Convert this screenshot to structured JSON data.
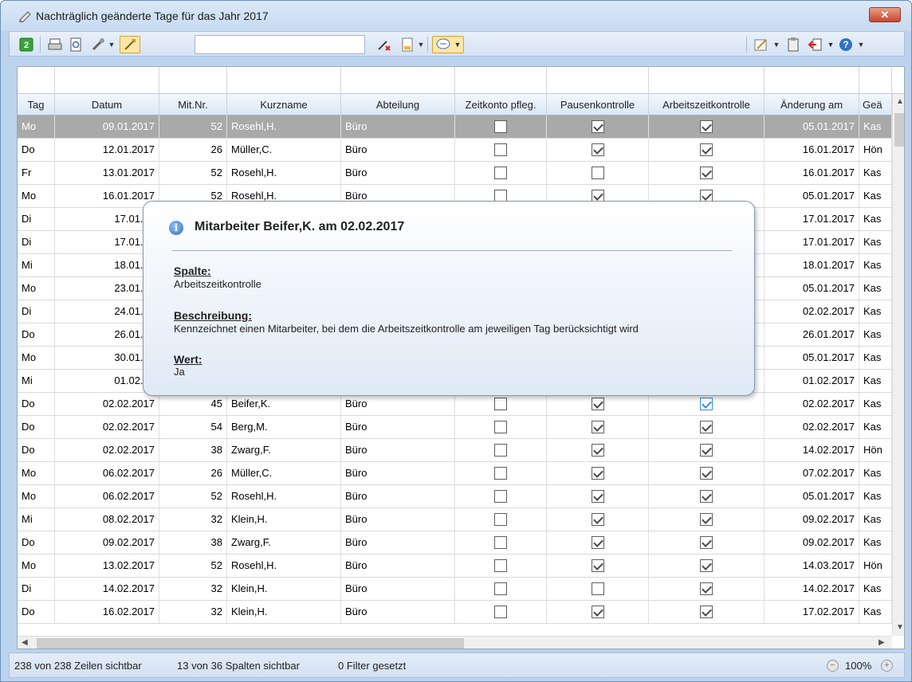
{
  "window": {
    "title": "Nachträglich geänderte Tage für das Jahr 2017",
    "close_label": "✕"
  },
  "toolbar": {
    "search_value": ""
  },
  "columns": [
    "Tag",
    "Datum",
    "Mit.Nr.",
    "Kurzname",
    "Abteilung",
    "Zeitkonto pfleg.",
    "Pausenkontrolle",
    "Arbeitszeitkontrolle",
    "Änderung am",
    "Geä"
  ],
  "rows": [
    {
      "tag": "Mo",
      "datum": "09.01.2017",
      "nr": "52",
      "kurz": "Rosehl,H.",
      "abt": "Büro",
      "zk": false,
      "pk": true,
      "ak": true,
      "aend": "05.01.2017",
      "gea": "Kas",
      "selected": true
    },
    {
      "tag": "Do",
      "datum": "12.01.2017",
      "nr": "26",
      "kurz": "Müller,C.",
      "abt": "Büro",
      "zk": false,
      "pk": true,
      "ak": true,
      "aend": "16.01.2017",
      "gea": "Hön"
    },
    {
      "tag": "Fr",
      "datum": "13.01.2017",
      "nr": "52",
      "kurz": "Rosehl,H.",
      "abt": "Büro",
      "zk": false,
      "pk": false,
      "ak": true,
      "aend": "16.01.2017",
      "gea": "Kas"
    },
    {
      "tag": "Mo",
      "datum": "16.01.2017",
      "nr": "52",
      "kurz": "Rosehl,H.",
      "abt": "Büro",
      "zk": false,
      "pk": true,
      "ak": true,
      "aend": "05.01.2017",
      "gea": "Kas"
    },
    {
      "tag": "Di",
      "datum": "17.01.20",
      "nr": "",
      "kurz": "",
      "abt": "",
      "zk": null,
      "pk": null,
      "ak": null,
      "aend": "17.01.2017",
      "gea": "Kas"
    },
    {
      "tag": "Di",
      "datum": "17.01.20",
      "nr": "",
      "kurz": "",
      "abt": "",
      "zk": null,
      "pk": null,
      "ak": null,
      "aend": "17.01.2017",
      "gea": "Kas"
    },
    {
      "tag": "Mi",
      "datum": "18.01.20",
      "nr": "",
      "kurz": "",
      "abt": "",
      "zk": null,
      "pk": null,
      "ak": null,
      "aend": "18.01.2017",
      "gea": "Kas"
    },
    {
      "tag": "Mo",
      "datum": "23.01.20",
      "nr": "",
      "kurz": "",
      "abt": "",
      "zk": null,
      "pk": null,
      "ak": null,
      "aend": "05.01.2017",
      "gea": "Kas"
    },
    {
      "tag": "Di",
      "datum": "24.01.20",
      "nr": "",
      "kurz": "",
      "abt": "",
      "zk": null,
      "pk": null,
      "ak": null,
      "aend": "02.02.2017",
      "gea": "Kas"
    },
    {
      "tag": "Do",
      "datum": "26.01.20",
      "nr": "",
      "kurz": "",
      "abt": "",
      "zk": null,
      "pk": null,
      "ak": null,
      "aend": "26.01.2017",
      "gea": "Kas"
    },
    {
      "tag": "Mo",
      "datum": "30.01.20",
      "nr": "",
      "kurz": "",
      "abt": "",
      "zk": null,
      "pk": null,
      "ak": null,
      "aend": "05.01.2017",
      "gea": "Kas"
    },
    {
      "tag": "Mi",
      "datum": "01.02.20",
      "nr": "",
      "kurz": "",
      "abt": "",
      "zk": null,
      "pk": null,
      "ak": null,
      "aend": "01.02.2017",
      "gea": "Kas"
    },
    {
      "tag": "Do",
      "datum": "02.02.2017",
      "nr": "45",
      "kurz": "Beifer,K.",
      "abt": "Büro",
      "zk": false,
      "pk": true,
      "ak": true,
      "aend": "02.02.2017",
      "gea": "Kas",
      "blue": true
    },
    {
      "tag": "Do",
      "datum": "02.02.2017",
      "nr": "54",
      "kurz": "Berg,M.",
      "abt": "Büro",
      "zk": false,
      "pk": true,
      "ak": true,
      "aend": "02.02.2017",
      "gea": "Kas"
    },
    {
      "tag": "Do",
      "datum": "02.02.2017",
      "nr": "38",
      "kurz": "Zwarg,F.",
      "abt": "Büro",
      "zk": false,
      "pk": true,
      "ak": true,
      "aend": "14.02.2017",
      "gea": "Hön"
    },
    {
      "tag": "Mo",
      "datum": "06.02.2017",
      "nr": "26",
      "kurz": "Müller,C.",
      "abt": "Büro",
      "zk": false,
      "pk": true,
      "ak": true,
      "aend": "07.02.2017",
      "gea": "Kas"
    },
    {
      "tag": "Mo",
      "datum": "06.02.2017",
      "nr": "52",
      "kurz": "Rosehl,H.",
      "abt": "Büro",
      "zk": false,
      "pk": true,
      "ak": true,
      "aend": "05.01.2017",
      "gea": "Kas"
    },
    {
      "tag": "Mi",
      "datum": "08.02.2017",
      "nr": "32",
      "kurz": "Klein,H.",
      "abt": "Büro",
      "zk": false,
      "pk": true,
      "ak": true,
      "aend": "09.02.2017",
      "gea": "Kas"
    },
    {
      "tag": "Do",
      "datum": "09.02.2017",
      "nr": "38",
      "kurz": "Zwarg,F.",
      "abt": "Büro",
      "zk": false,
      "pk": true,
      "ak": true,
      "aend": "09.02.2017",
      "gea": "Kas"
    },
    {
      "tag": "Mo",
      "datum": "13.02.2017",
      "nr": "52",
      "kurz": "Rosehl,H.",
      "abt": "Büro",
      "zk": false,
      "pk": true,
      "ak": true,
      "aend": "14.03.2017",
      "gea": "Hön"
    },
    {
      "tag": "Di",
      "datum": "14.02.2017",
      "nr": "32",
      "kurz": "Klein,H.",
      "abt": "Büro",
      "zk": false,
      "pk": false,
      "ak": true,
      "aend": "14.02.2017",
      "gea": "Kas"
    },
    {
      "tag": "Do",
      "datum": "16.02.2017",
      "nr": "32",
      "kurz": "Klein,H.",
      "abt": "Büro",
      "zk": false,
      "pk": true,
      "ak": true,
      "aend": "17.02.2017",
      "gea": "Kas"
    }
  ],
  "tooltip": {
    "title": "Mitarbeiter Beifer,K. am 02.02.2017",
    "spalte_label": "Spalte:",
    "spalte_value": "Arbeitszeitkontrolle",
    "beschreibung_label": "Beschreibung:",
    "beschreibung_value": "Kennzeichnet einen Mitarbeiter, bei dem die Arbeitszeitkontrolle am jeweiligen Tag berücksichtigt wird",
    "wert_label": "Wert:",
    "wert_value": "Ja"
  },
  "status": {
    "rows_visible": "238 von 238 Zeilen sichtbar",
    "cols_visible": "13 von 36 Spalten sichtbar",
    "filters": "0 Filter gesetzt",
    "zoom": "100%"
  },
  "colors": {
    "selected_row": "#a9a9a9",
    "accent": "#3b8de0",
    "close": "#c9442c"
  }
}
